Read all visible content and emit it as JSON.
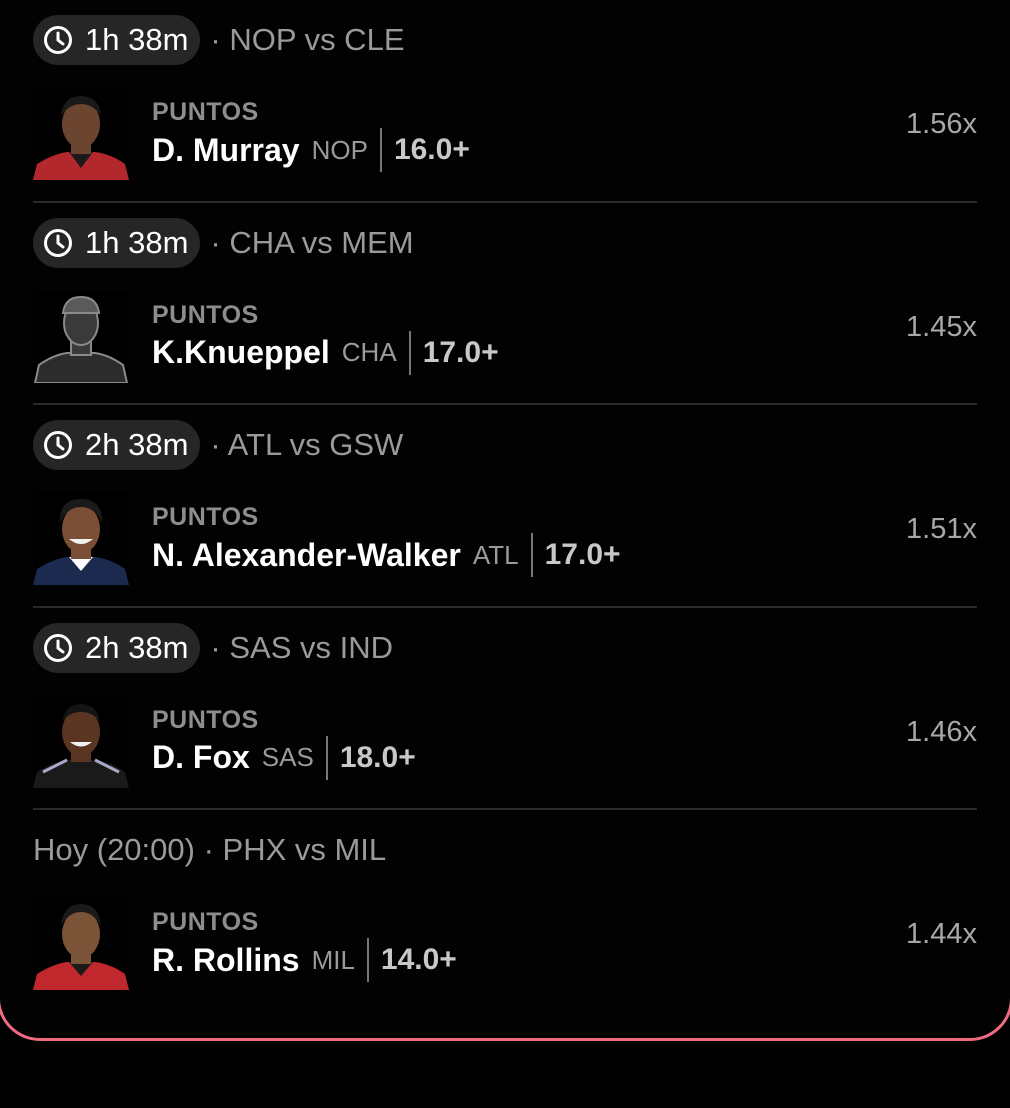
{
  "colors": {
    "background": "#000000",
    "pill": "#262626",
    "frame_accent": "#f06a80"
  },
  "rows": [
    {
      "time": "1h 38m",
      "game": "· NOP vs CLE",
      "market": "PUNTOS",
      "player": "D. Murray",
      "team": "NOP",
      "line": "16.0+",
      "odds": "1.56x",
      "jersey_color": "#b3282d",
      "skin": "#6b4530"
    },
    {
      "time": "1h 38m",
      "game": "· CHA vs MEM",
      "market": "PUNTOS",
      "player": "K.Knueppel",
      "team": "CHA",
      "line": "17.0+",
      "odds": "1.45x",
      "placeholder_avatar": true
    },
    {
      "time": "2h 38m",
      "game": "· ATL vs GSW",
      "market": "PUNTOS",
      "player": "N. Alexander-Walker",
      "team": "ATL",
      "line": "17.0+",
      "odds": "1.51x",
      "jersey_color": "#1d2a50",
      "skin": "#7a4f35"
    },
    {
      "time": "2h 38m",
      "game": "· SAS vs IND",
      "market": "PUNTOS",
      "player": "D. Fox",
      "team": "SAS",
      "line": "18.0+",
      "odds": "1.46x",
      "jersey_color": "#1a1a1a",
      "skin": "#5a3522"
    },
    {
      "header": "Hoy (20:00) · PHX vs MIL",
      "market": "PUNTOS",
      "player": "R. Rollins",
      "team": "MIL",
      "line": "14.0+",
      "odds": "1.44x",
      "jersey_color": "#c0282d",
      "skin": "#7b5438"
    }
  ]
}
